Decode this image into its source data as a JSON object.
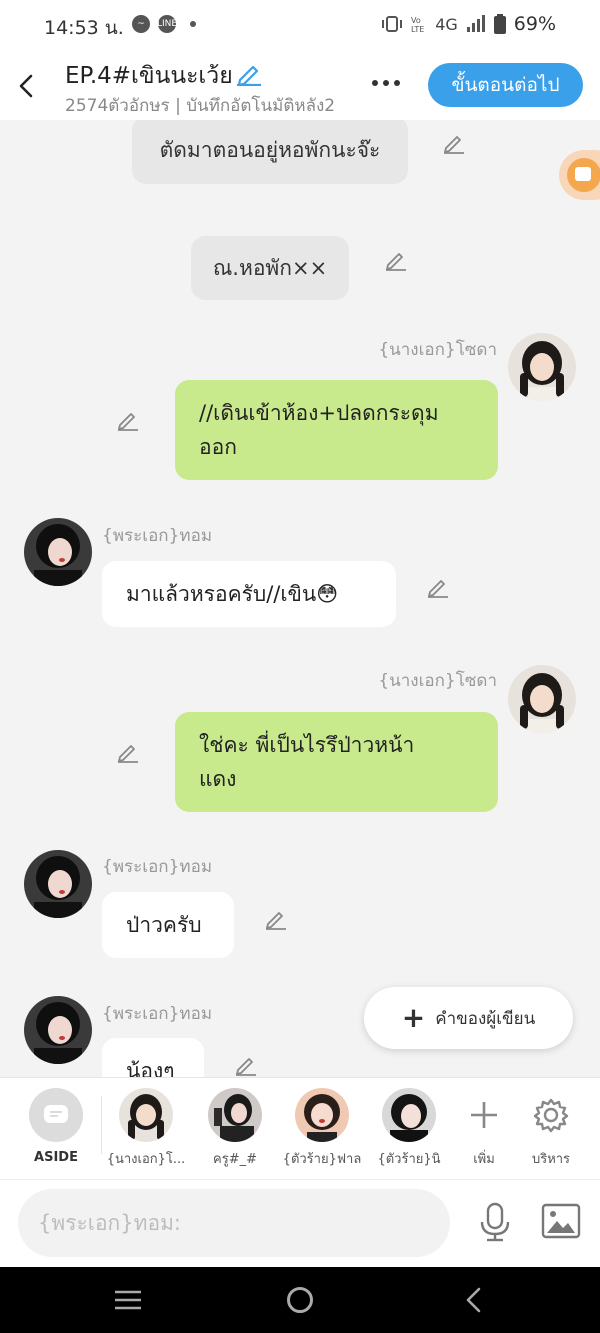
{
  "status_bar": {
    "time": "14:53 น.",
    "network": "4G",
    "battery": "69%",
    "line_label": "LINE"
  },
  "header": {
    "title": "EP.4#เขินนะเว้ย",
    "subtitle": "2574ตัวอักษร | บันทึกอัตโนมัติหลัง2",
    "next_button": "ขั้นตอนต่อไป"
  },
  "messages": [
    {
      "type": "narration",
      "text": "ตัดมาตอนอยู่หอพักนะจ๊ะ"
    },
    {
      "type": "narration",
      "text": "ณ.หอพัก××"
    },
    {
      "type": "right",
      "speaker": "{นางเอก}โซดา",
      "lines": [
        "//เดินเข้าห้อง+ปลดกระดุม",
        "ออก"
      ]
    },
    {
      "type": "left",
      "speaker": "{พระเอก}ทอม",
      "text": "มาแล้วหรอครับ//เขิน😳"
    },
    {
      "type": "right",
      "speaker": "{นางเอก}โซดา",
      "lines": [
        "ใช่คะ พี่เป็นไรรึป่าวหน้า",
        "แดง"
      ]
    },
    {
      "type": "left",
      "speaker": "{พระเอก}ทอม",
      "text": "ป่าวครับ"
    },
    {
      "type": "left",
      "speaker": "{พระเอก}ทอม",
      "text": "น้องๆ"
    }
  ],
  "author_note_button": "คำของผู้เขียน",
  "character_bar": {
    "aside": "ASIDE",
    "characters": [
      {
        "label": "{นางเอก}โ..."
      },
      {
        "label": "ครู#_#"
      },
      {
        "label": "{ตัวร้าย}ฟาล"
      },
      {
        "label": "{ตัวร้าย}นิ"
      }
    ],
    "add": "เพิ่ม",
    "manage": "บริหาร"
  },
  "input": {
    "placeholder": "{พระเอก}ทอม:"
  },
  "colors": {
    "accent": "#3aa0ea",
    "right_bubble": "#c9ea8c",
    "narration_bubble": "#e7e7e7",
    "background": "#f3f3f3"
  }
}
